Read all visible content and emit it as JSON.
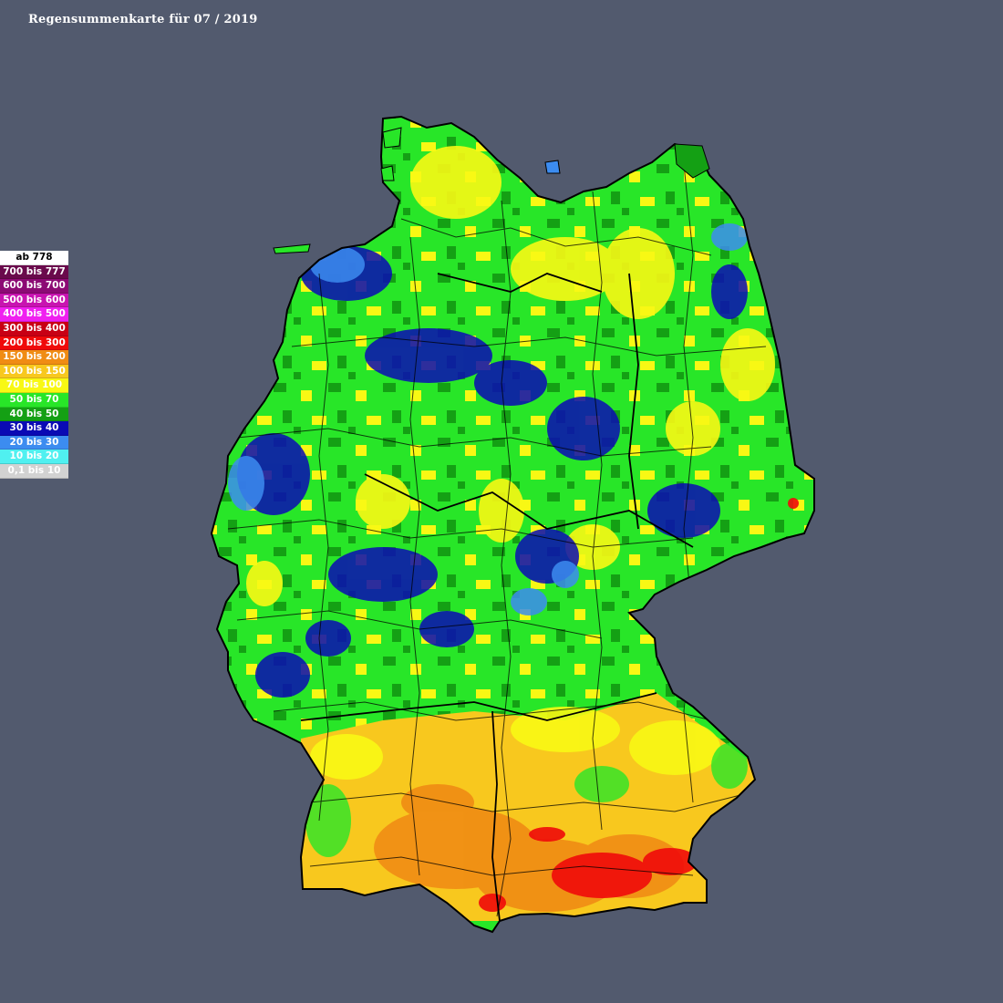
{
  "title": "Regensummenkarte für 07 / 2019",
  "legend": [
    {
      "label": "ab 778",
      "color": "#ffffff",
      "text": "#000000"
    },
    {
      "label": "700 bis 777",
      "color": "#6a0a4c",
      "text": "#ffffff"
    },
    {
      "label": "600 bis 700",
      "color": "#8c0a74",
      "text": "#ffffff"
    },
    {
      "label": "500 bis 600",
      "color": "#c814b0",
      "text": "#ffffff"
    },
    {
      "label": "400 bis 500",
      "color": "#f020f0",
      "text": "#ffffff"
    },
    {
      "label": "300 bis 400",
      "color": "#c80014",
      "text": "#ffffff"
    },
    {
      "label": "200 bis 300",
      "color": "#f00a0a",
      "text": "#ffffff"
    },
    {
      "label": "150 bis 200",
      "color": "#f08c14",
      "text": "#ffffff"
    },
    {
      "label": "100 bis 150",
      "color": "#f8c81e",
      "text": "#ffffff"
    },
    {
      "label": "70 bis 100",
      "color": "#f8f814",
      "text": "#ffffff"
    },
    {
      "label": "50 bis 70",
      "color": "#28e628",
      "text": "#ffffff"
    },
    {
      "label": "40 bis 50",
      "color": "#14a014",
      "text": "#ffffff"
    },
    {
      "label": "30 bis 40",
      "color": "#0a0ab4",
      "text": "#ffffff"
    },
    {
      "label": "20 bis 30",
      "color": "#3c8cf0",
      "text": "#ffffff"
    },
    {
      "label": "10 bis 20",
      "color": "#50f0f0",
      "text": "#ffffff"
    },
    {
      "label": "0,1 bis 10",
      "color": "#d2d2d2",
      "text": "#ffffff"
    }
  ]
}
